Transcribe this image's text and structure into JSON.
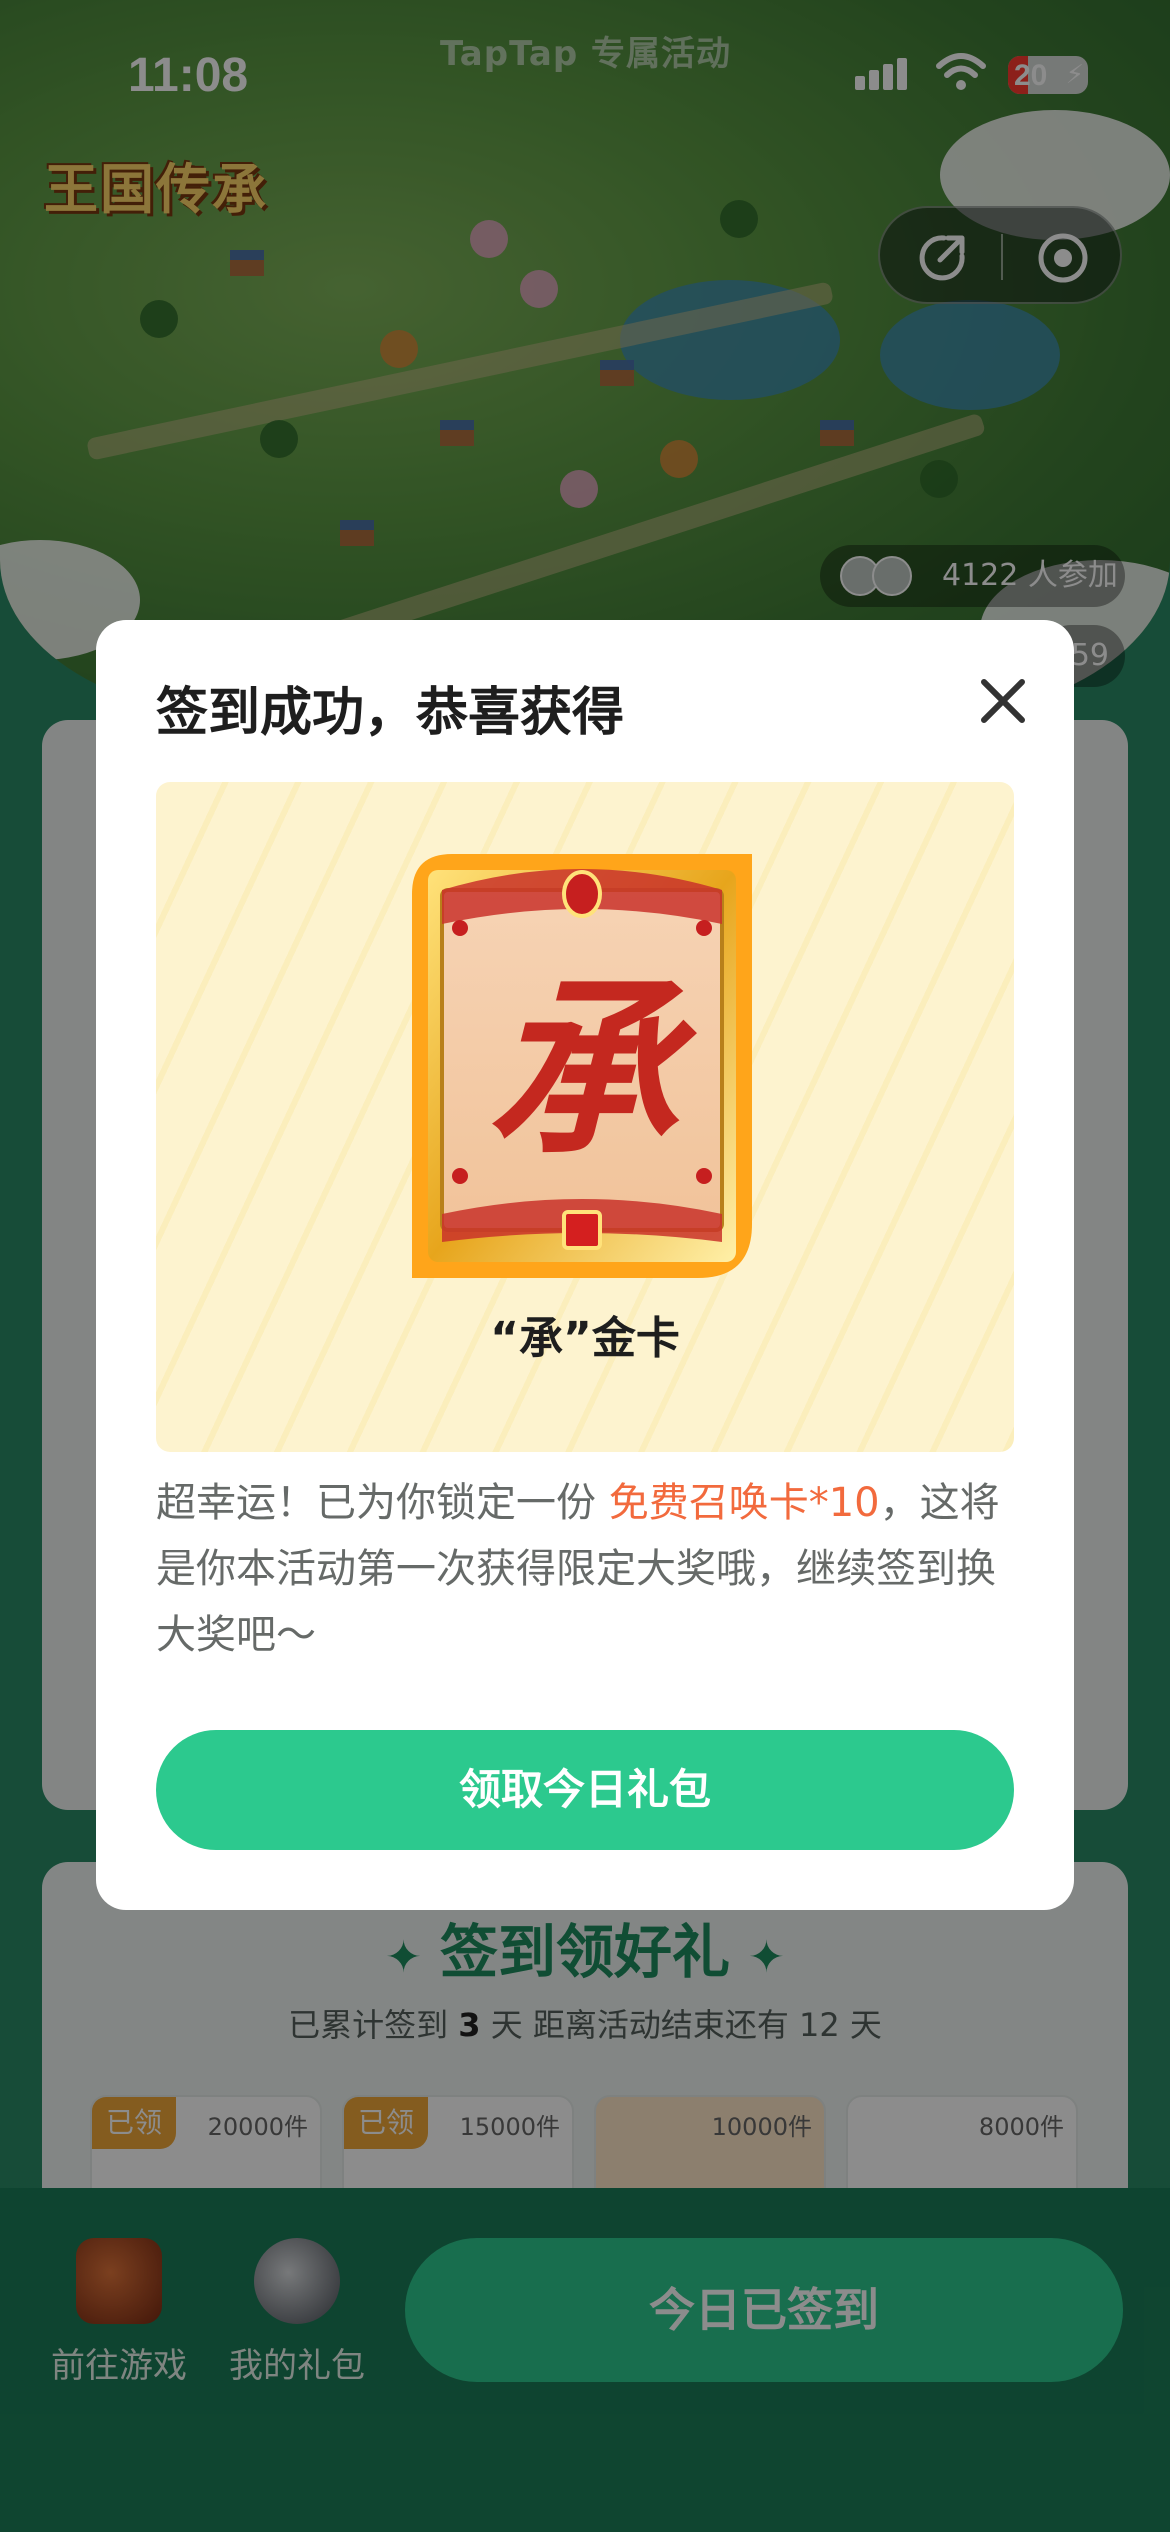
{
  "status_bar": {
    "time": "11:08",
    "battery": "20"
  },
  "header": {
    "brand": "TapTap 专属活动"
  },
  "game": {
    "logo_text": "王国传承"
  },
  "activity": {
    "participants": "4122 人参加",
    "secondary_count": "59"
  },
  "sign_section": {
    "title": "签到领好礼",
    "subtitle_prefix": "已累计签到 ",
    "days": "3",
    "subtitle_suffix": " 天  距离活动结束还有 12 天",
    "gifts": [
      {
        "badge": "已领",
        "count": "20000件"
      },
      {
        "badge": "已领",
        "count": "15000件"
      },
      {
        "badge": "",
        "count": "10000件"
      },
      {
        "badge": "",
        "count": "8000件"
      }
    ]
  },
  "bottom_bar": {
    "goto_game": "前往游戏",
    "my_gifts": "我的礼包",
    "signed_button": "今日已签到"
  },
  "modal": {
    "title": "签到成功，恭喜获得",
    "reward_name": "“承”金卡",
    "card_glyph": "承",
    "desc_before": "超幸运！已为你锁定一份 ",
    "desc_highlight": "免费召唤卡*10",
    "desc_after": "，这将是你本活动第一次获得限定大奖哦，继续签到换大奖吧～",
    "claim_button": "领取今日礼包"
  },
  "colors": {
    "accent_green": "#2cc98e",
    "highlight_orange": "#f26a3d",
    "badge_orange": "#f0a83a"
  },
  "icons": {
    "close": "close-icon",
    "share": "share-icon",
    "record": "record-icon",
    "wifi": "wifi-icon",
    "signal": "signal-icon"
  }
}
